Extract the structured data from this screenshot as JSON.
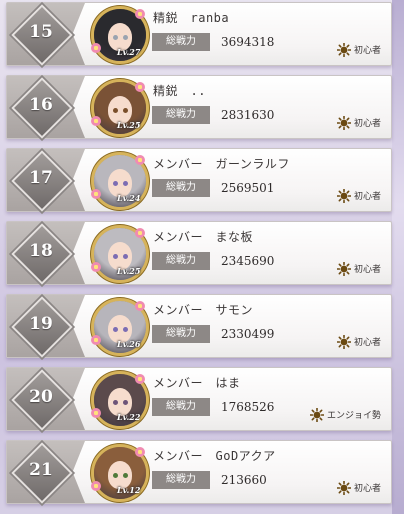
{
  "ranking": {
    "power_label": "総戦力",
    "rows": [
      {
        "rank": "15",
        "name": "精鋭　ranba",
        "level": "Lv.27",
        "power": "3694318",
        "style": "初心者",
        "hair": "#2a2a2e",
        "eye": "#9aa3b0"
      },
      {
        "rank": "16",
        "name": "精鋭　..",
        "level": "Lv.25",
        "power": "2831630",
        "style": "初心者",
        "hair": "#7a5236",
        "eye": "#7a4f2a"
      },
      {
        "rank": "17",
        "name": "メンバー　ガーンラルフ",
        "level": "Lv.24",
        "power": "2569501",
        "style": "初心者",
        "hair": "#b9b7bd",
        "eye": "#7c6db3"
      },
      {
        "rank": "18",
        "name": "メンバー　まな板",
        "level": "Lv.25",
        "power": "2345690",
        "style": "初心者",
        "hair": "#bdbbc0",
        "eye": "#7c6db3"
      },
      {
        "rank": "19",
        "name": "メンバー　サモン",
        "level": "Lv.26",
        "power": "2330499",
        "style": "初心者",
        "hair": "#b7b5bb",
        "eye": "#7c6db3"
      },
      {
        "rank": "20",
        "name": "メンバー　はま",
        "level": "Lv.22",
        "power": "1768526",
        "style": "エンジョイ勢",
        "hair": "#5b4a4c",
        "eye": "#6d5478"
      },
      {
        "rank": "21",
        "name": "メンバー　GoDアクア",
        "level": "Lv.12",
        "power": "213660",
        "style": "初心者",
        "hair": "#8a5e3c",
        "eye": "#4f7a3a"
      }
    ]
  }
}
